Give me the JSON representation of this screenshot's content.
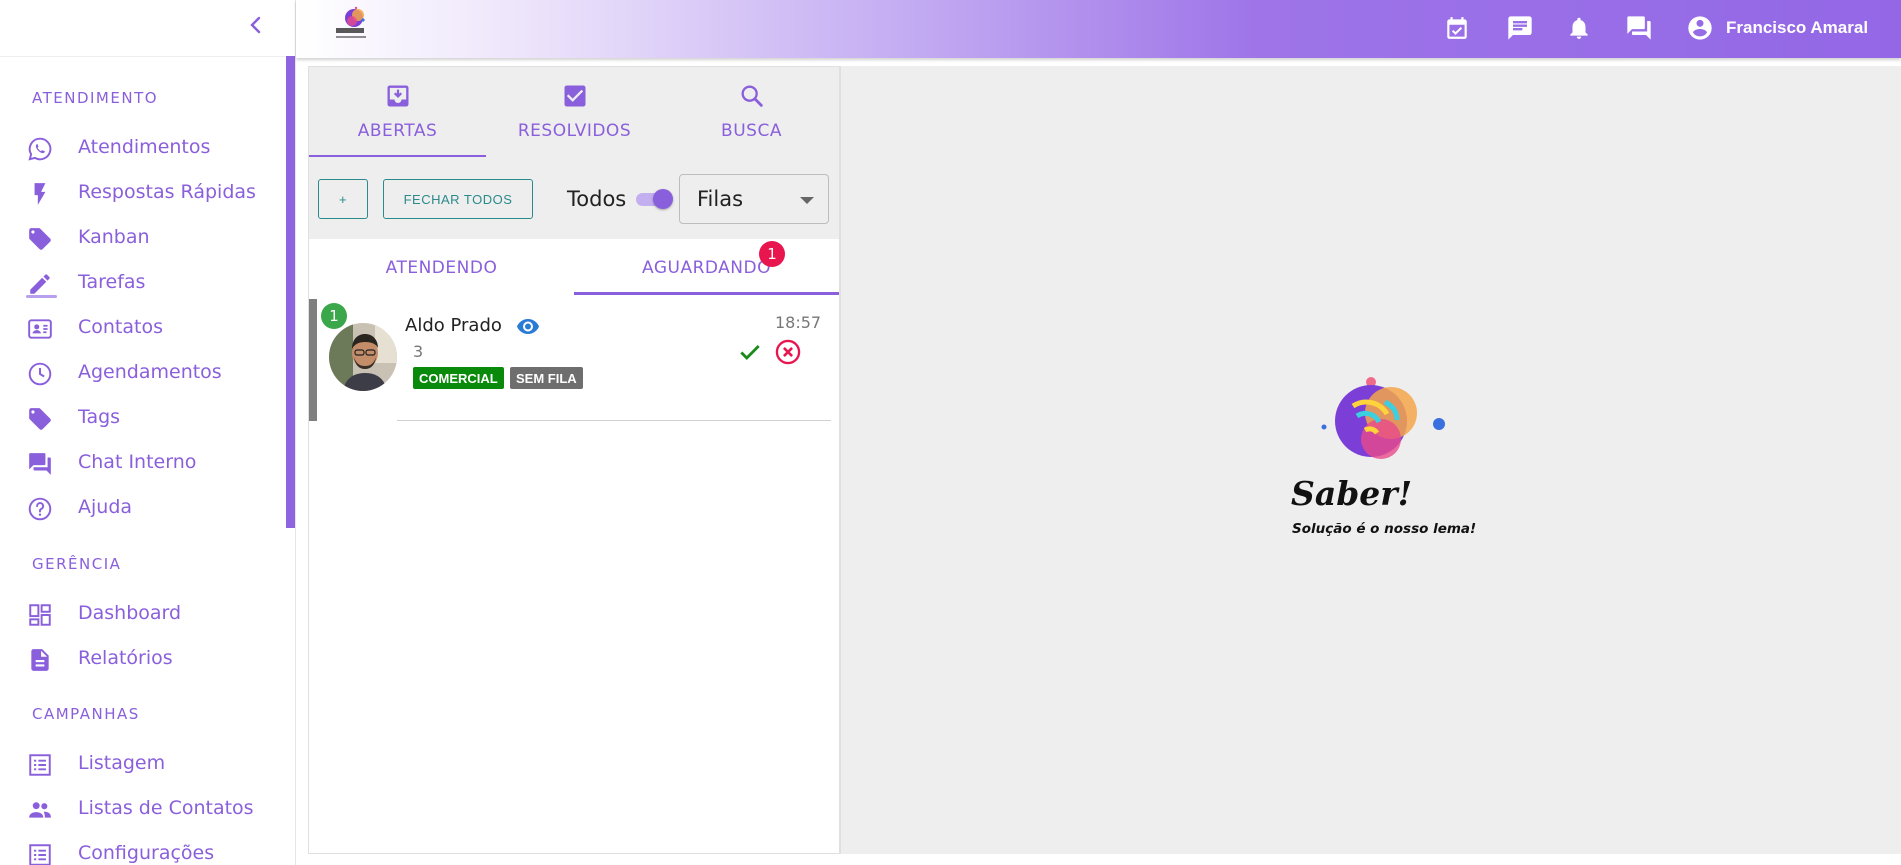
{
  "app": {
    "brand": "Saber!",
    "slogan": "Solução é o nosso lema!"
  },
  "colors": {
    "accent": "#8a5fdc",
    "teal_button": "#2b8a8a",
    "badge_red": "#e8154f",
    "badge_green": "#3aa84a",
    "tag_comercial": "#0a8a0a",
    "tag_sem_fila": "#6e6e6e"
  },
  "sidebar": {
    "sections": [
      {
        "title": "ATENDIMENTO",
        "items": [
          {
            "label": "Atendimentos",
            "icon": "whatsapp-icon"
          },
          {
            "label": "Respostas Rápidas",
            "icon": "flash-icon"
          },
          {
            "label": "Kanban",
            "icon": "tag-icon"
          },
          {
            "label": "Tarefas",
            "icon": "pencil-icon"
          },
          {
            "label": "Contatos",
            "icon": "contact-card-icon"
          },
          {
            "label": "Agendamentos",
            "icon": "clock-icon"
          },
          {
            "label": "Tags",
            "icon": "tag-icon"
          },
          {
            "label": "Chat Interno",
            "icon": "forum-icon"
          },
          {
            "label": "Ajuda",
            "icon": "help-icon"
          }
        ]
      },
      {
        "title": "GERÊNCIA",
        "items": [
          {
            "label": "Dashboard",
            "icon": "dashboard-icon"
          },
          {
            "label": "Relatórios",
            "icon": "document-icon"
          }
        ]
      },
      {
        "title": "CAMPANHAS",
        "items": [
          {
            "label": "Listagem",
            "icon": "list-icon"
          },
          {
            "label": "Listas de Contatos",
            "icon": "people-icon"
          },
          {
            "label": "Configurações",
            "icon": "list-icon"
          }
        ]
      }
    ]
  },
  "topbar": {
    "user_name": "Francisco Amaral",
    "icons": [
      "calendar-check-icon",
      "chat-icon",
      "bell-icon",
      "forum-icon",
      "account-icon"
    ]
  },
  "tickets": {
    "main_tabs": [
      {
        "label": "ABERTAS",
        "icon": "inbox-icon",
        "active": true
      },
      {
        "label": "RESOLVIDOS",
        "icon": "check-box-icon",
        "active": false
      },
      {
        "label": "BUSCA",
        "icon": "search-icon",
        "active": false
      }
    ],
    "toolbar": {
      "add_label": "+",
      "close_all_label": "FECHAR TODOS",
      "todos_label": "Todos",
      "todos_on": true,
      "queue_select_value": "Filas"
    },
    "sub_tabs": [
      {
        "label": "ATENDENDO",
        "active": false
      },
      {
        "label": "AGUARDANDO",
        "active": true,
        "badge": "1"
      }
    ],
    "items": [
      {
        "name": "Aldo Prado",
        "unread": "1",
        "last_message": "3",
        "time": "18:57",
        "tags": [
          "COMERCIAL",
          "SEM FILA"
        ]
      }
    ]
  }
}
